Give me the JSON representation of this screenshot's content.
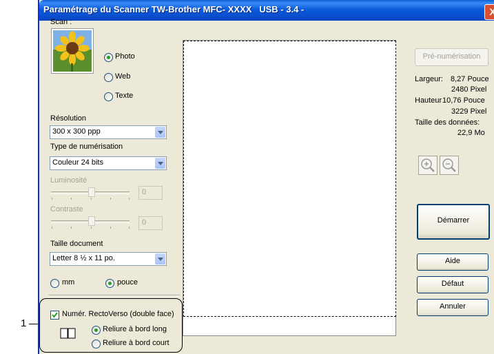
{
  "callout": {
    "number": "1"
  },
  "window": {
    "title": "Paramétrage du Scanner TW-Brother MFC- XXXX   USB - 3.4 -",
    "close_glyph": "X"
  },
  "scan": {
    "label": "Scan :",
    "options": [
      {
        "label": "Photo",
        "selected": true
      },
      {
        "label": "Web",
        "selected": false
      },
      {
        "label": "Texte",
        "selected": false
      }
    ]
  },
  "resolution": {
    "label": "Résolution",
    "value": "300 x 300 ppp"
  },
  "scan_type": {
    "label": "Type de numérisation",
    "value": "Couleur 24 bits"
  },
  "brightness": {
    "label": "Luminosité",
    "value": "0",
    "level": 0.5
  },
  "contrast": {
    "label": "Contraste",
    "value": "0",
    "level": 0.5
  },
  "doc_size": {
    "label": "Taille document",
    "value": "Letter 8 ½ x 11 po."
  },
  "units": [
    {
      "label": "mm",
      "selected": false
    },
    {
      "label": "pouce",
      "selected": true
    }
  ],
  "duplex": {
    "label": "Numér. RectoVerso (double face)",
    "checked": true,
    "options": [
      {
        "label": "Reliure à bord long",
        "selected": true
      },
      {
        "label": "Reliure à bord court",
        "selected": false
      }
    ]
  },
  "right_panel": {
    "prescan_label": "Pré-numérisation",
    "width_label": "Largeur:",
    "width_inch": "8,27 Pouce",
    "width_px": "2480 Pixel",
    "height_label": "Hauteur",
    "height_inch": "10,76 Pouce",
    "height_px": "3229 Pixel",
    "datasize_label": "Taille des données:",
    "datasize_value": "22,9 Mo",
    "start_label": "Démarrer",
    "help_label": "Aide",
    "default_label": "Défaut",
    "cancel_label": "Annuler"
  },
  "colors": {
    "titlebar": "#0b5bdb",
    "dialog_bg": "#ece9d8",
    "accent": "#21a121",
    "close": "#d8502f"
  }
}
